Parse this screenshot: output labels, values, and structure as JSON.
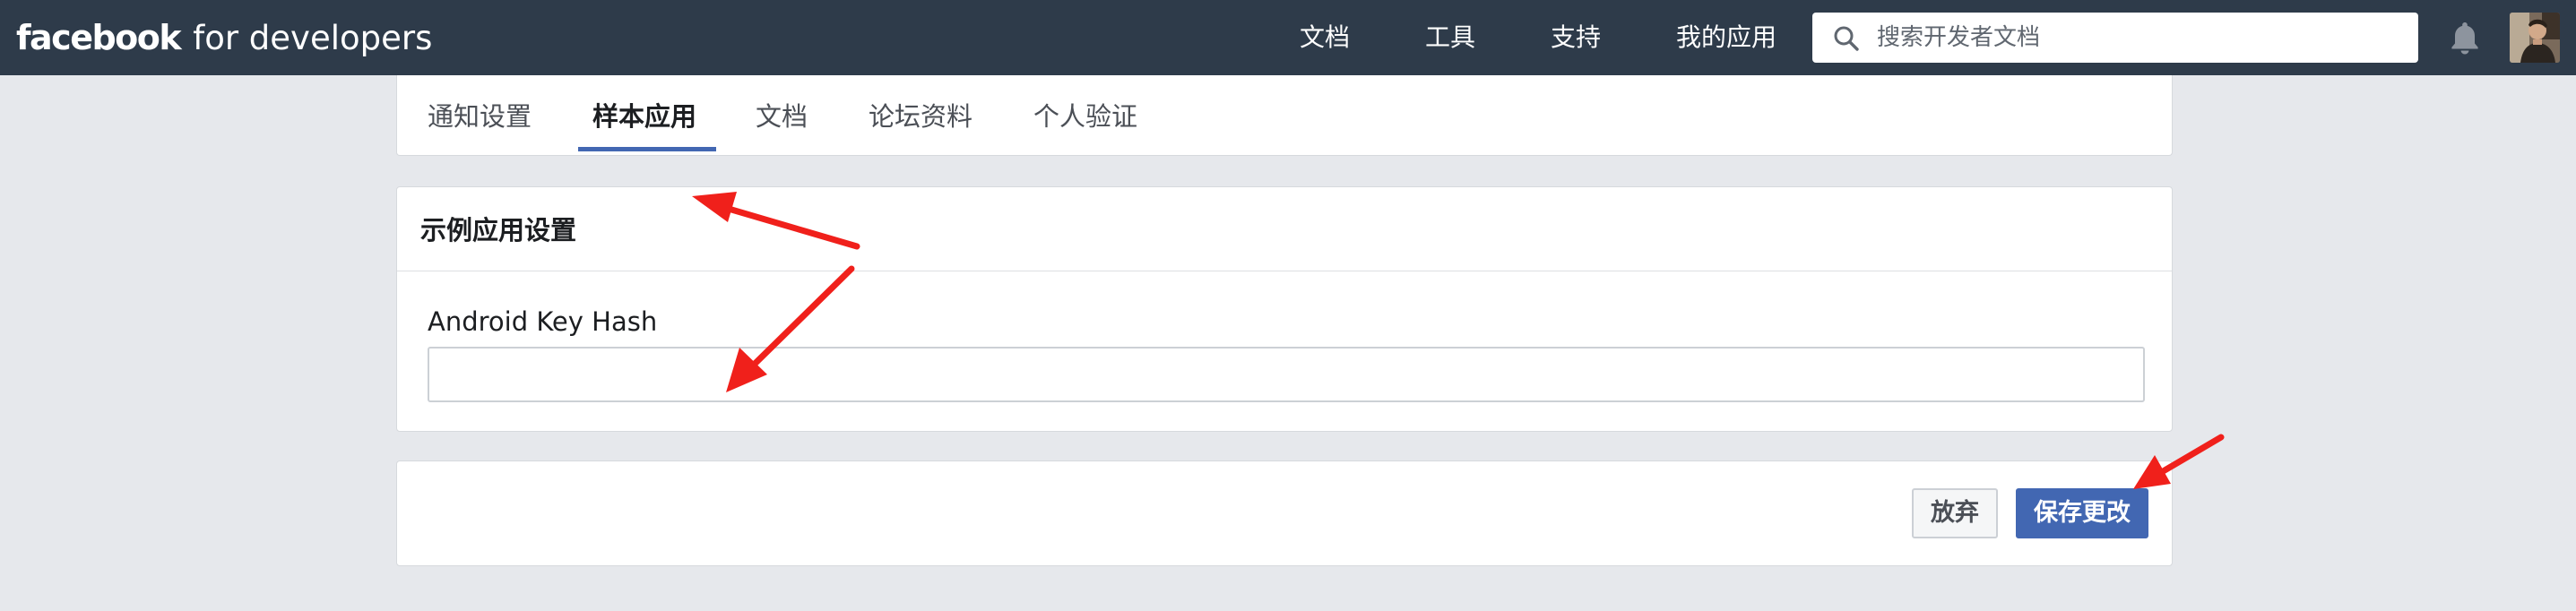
{
  "topbar": {
    "brand_primary": "facebook",
    "brand_secondary": "for developers",
    "nav": [
      {
        "label": "文档"
      },
      {
        "label": "工具"
      },
      {
        "label": "支持"
      },
      {
        "label": "我的应用"
      }
    ],
    "search": {
      "placeholder": "搜索开发者文档",
      "icon": "search-icon"
    },
    "notifications_icon": "bell-icon",
    "avatar_icon": "avatar"
  },
  "tabs": {
    "items": [
      {
        "label": "通知设置",
        "active": false
      },
      {
        "label": "样本应用",
        "active": true
      },
      {
        "label": "文档",
        "active": false
      },
      {
        "label": "论坛资料",
        "active": false
      },
      {
        "label": "个人验证",
        "active": false
      }
    ],
    "active_color": "#4267b2"
  },
  "settings": {
    "title": "示例应用设置",
    "field": {
      "label": "Android Key Hash",
      "value": ""
    }
  },
  "actions": {
    "discard_label": "放弃",
    "save_label": "保存更改"
  },
  "colors": {
    "topbar_bg": "#2e3b4a",
    "page_bg": "#e6e8ec",
    "primary": "#4267b2",
    "annotation": "#f0201b"
  }
}
